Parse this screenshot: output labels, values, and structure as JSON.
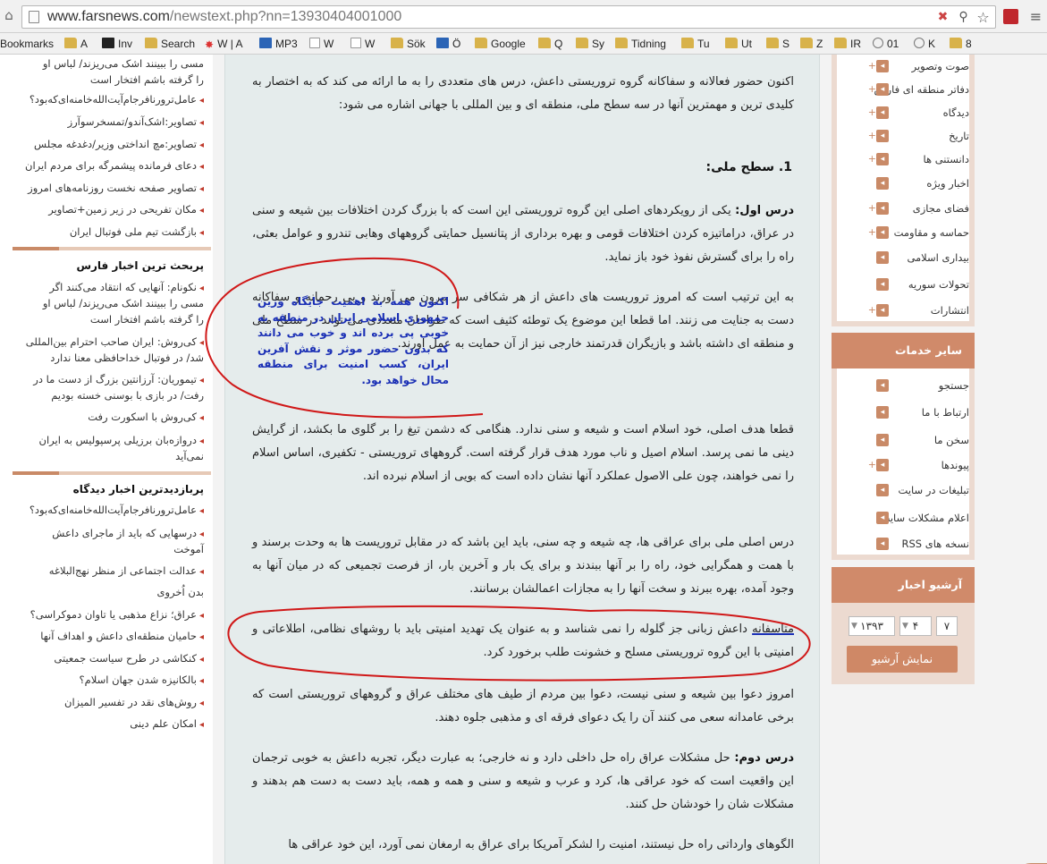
{
  "browser": {
    "url_host": "www.farsnews.com",
    "url_path": "/newstext.php?nn=13930404001000",
    "bookmarks_label": "Bookmarks",
    "bookmarks": [
      {
        "label": "A",
        "icon": "folder-icon"
      },
      {
        "label": "Inv",
        "icon": "page-icon"
      },
      {
        "label": "Search",
        "icon": "folder-icon"
      },
      {
        "label": "W | A",
        "icon": "sun-icon"
      },
      {
        "label": "MP3",
        "icon": "mp3-icon"
      },
      {
        "label": "W",
        "icon": "wiki-icon"
      },
      {
        "label": "W",
        "icon": "wiki-icon"
      },
      {
        "label": "Sök",
        "icon": "folder-icon"
      },
      {
        "label": "Ö",
        "icon": "app-icon"
      },
      {
        "label": "Google",
        "icon": "folder-icon"
      },
      {
        "label": "Q",
        "icon": "folder-icon"
      },
      {
        "label": "Sy",
        "icon": "folder-icon"
      },
      {
        "label": "Tidning",
        "icon": "folder-icon"
      },
      {
        "label": "Tu",
        "icon": "folder-icon"
      },
      {
        "label": "Ut",
        "icon": "folder-icon"
      },
      {
        "label": "S",
        "icon": "folder-icon"
      },
      {
        "label": "Z",
        "icon": "folder-icon"
      },
      {
        "label": "IR",
        "icon": "folder-icon"
      },
      {
        "label": "01",
        "icon": "clock-icon"
      },
      {
        "label": "K",
        "icon": "clock-icon"
      },
      {
        "label": "8",
        "icon": "folder-icon"
      }
    ]
  },
  "left": {
    "top_links": [
      "مسی را ببینند اشک می‌ریزند/ لباس او",
      "را گرفته باشم افتخار است",
      "عامل‌ترورنافرجام‌آیت‌الله‌خامنه‌ای‌که‌بود؟",
      "تصاویر:اشک‌آندو/تمسخرسوآرز",
      "تصاویر:مچ انداختی وزیر/دغدغه مجلس",
      "دعای فرمانده پیشمرگه برای مردم ایران",
      "تصاویر صفحه نخست روزنامه‌های امروز",
      "مکان تفریحی در زیر زمین+تصاویر",
      "بازگشت تیم ملی فوتبال ایران"
    ],
    "section1_title": "پربحث ترین اخبار فارس",
    "section1_links": [
      "نکونام: آنهایی که انتقاد می‌کنند اگر",
      "مسی را ببینند اشک می‌ریزند/ لباس او",
      "را گرفته باشم افتخار است",
      "کی‌روش: ایران صاحب احترام بین‌المللی",
      "شد/ در فوتبال خداحافظی معنا ندارد",
      "تیموریان: آرزانتین بزرگ از دست ما در",
      "رفت/ در بازی با بوسنی خسته بودیم",
      "کی‌روش با اسکورت رفت",
      "دروازه‌بان برزیلی پرسپولیس به ایران",
      "نمی‌آید"
    ],
    "section2_title": "پربازدیدترین اخبار دیدگاه",
    "section2_links": [
      "عامل‌ترورنافرجام‌آیت‌الله‌خامنه‌ای‌که‌بود؟",
      "درسهایی که باید از ماجرای داعش",
      "آموخت",
      "عدالت اجتماعی از منظر نهج‌البلاغه",
      "بدن اُخروی",
      "عراق؛ نزاع مذهبی یا تاوان دموکراسی؟",
      "حامیان منطقه‌ای داعش و اهداف آنها",
      "کنکاشی در طرح سیاست جمعیتی",
      "بالکانیزه شدن جهان اسلام؟",
      "روش‌های نقد در تفسیر المیزان",
      "امکان علم دینی"
    ]
  },
  "article": {
    "intro": "اکنون حضور فعالانه و سفاکانه گروه تروریستی داعش، درس های متعددی را به ما ارائه می کند که به اختصار به کلیدی ترین و مهمترین آنها در سه سطح ملی، منطقه ای و بین المللی با جهانی اشاره می شود:",
    "heading1": "1. سطح ملی:",
    "lesson1_label": "درس اول:",
    "lesson1_text": " یکی از رویکردهای اصلی این گروه تروریستی این است که با بزرگ کردن اختلافات بین شیعه و سنی در عراق، دراماتیزه کردن اختلافات قومی و بهره برداری از پتانسیل حمایتی گروههای وهابی تندرو و عوامل بعثی، راه را برای گسترش نفوذ خود باز نماید.",
    "p3": "به این ترتیب است که امروز تروریست های داعش از هر شکافی سر بیرون می آورند و بی رحمانه و سفاکانه دست به جنایت می زنند. اما قطعا این موضوع یک توطئه کثیف است که طراحان متعددی می تواند در سطح ملی و منطقه ای داشته باشد و بازیگران قدرتمند خارجی نیز از آن حمایت به عمل آورند.",
    "p4": "قطعا هدف اصلی، خود اسلام است و شیعه و سنی ندارد. هنگامی که دشمن تیغ را بر گلوی ما بکشد، از گرایش دینی ما نمی پرسد. اسلام اصیل و ناب مورد هدف قرار گرفته است. گروههای تروریستی - تکفیری، اساس اسلام را نمی خواهند، چون علی الاصول عملکرد آنها نشان داده است که بویی از اسلام نبرده اند.",
    "p5": "درس اصلی ملی برای عراقی ها، چه شیعه و چه سنی، باید این باشد که در مقابل تروریست ها به وحدت برسند و با همت و همگرایی خود، راه را بر آنها ببندند و برای یک بار و آخرین بار، از فرصت تجمیعی که در میان آنها به وجود آمده، بهره ببرند و سخت آنها را به مجازات اعمالشان برسانند.",
    "p6_first_word": "متاسفانه",
    "p6_rest": " داعش زبانی جز گلوله را نمی شناسد و به عنوان یک تهدید امنیتی باید با روشهای نظامی، اطلاعاتی و امنیتی با این گروه تروریستی مسلح و خشونت طلب برخورد کرد.",
    "p7": "امروز دعوا بین شیعه و سنی نیست، دعوا بین مردم از طیف های مختلف عراق و گروههای تروریستی است که برخی عامدانه سعی می کنند آن را یک دعوای فرقه ای و مذهبی جلوه دهند.",
    "lesson2_label": "درس دوم:",
    "lesson2_text": " حل مشکلات عراق راه حل داخلی دارد و نه خارجی؛ به عبارت دیگر، تجربه داعش به خوبی ترجمان این واقعیت است که خود عراقی ها، کرد و عرب و شیعه و سنی و همه و همه، باید دست به دست هم بدهند و مشکلات شان را خودشان حل کنند.",
    "p9": "الگوهای وارداتی راه حل نیستند، امنیت را لشکر آمریکا برای عراق به ارمغان نمی آورد، این خود عراقی ها",
    "callout": "اکنون همه به اهمیت جایگاه وزین جمهوری اسلامی ایران در منطقه به خوبی پی برده اند و خوب می دانند که بدون حضور موثر و نقش آفرین ایران، کسب امنیت برای منطقه محال خواهد بود."
  },
  "right": {
    "menu_items": [
      {
        "label": "صوت وتصویر",
        "plus": true
      },
      {
        "label": "دفاتر منطقه ای فارس",
        "plus": true
      },
      {
        "label": "دیدگاه",
        "plus": true
      },
      {
        "label": "تاریخ",
        "plus": true
      },
      {
        "label": "دانستنی ها",
        "plus": true
      },
      {
        "label": "اخبار ویژه",
        "plus": false
      },
      {
        "label": "فضای مجازی",
        "plus": true
      },
      {
        "label": "حماسه و مقاومت",
        "plus": true
      },
      {
        "label": "بیداری اسلامی",
        "plus": false
      },
      {
        "label": "تحولات سوریه",
        "plus": false
      },
      {
        "label": "انتشارات",
        "plus": true
      }
    ],
    "services_title": "سایر خدمات",
    "services": [
      {
        "label": "جستجو",
        "plus": false
      },
      {
        "label": "ارتباط با ما",
        "plus": false
      },
      {
        "label": "سخن ما",
        "plus": false
      },
      {
        "label": "پیوندها",
        "plus": true
      },
      {
        "label": "تبلیغات در سایت",
        "plus": false
      },
      {
        "label": "اعلام مشکلات سایت",
        "plus": false
      },
      {
        "label": "نسخه های RSS",
        "plus": false
      }
    ],
    "archive_title": "آرشیو اخبار",
    "archive_day": "۷",
    "archive_month": "۴",
    "archive_year": "۱۳۹۳",
    "archive_button": "نمایش آرشیو"
  },
  "colors": {
    "accent": "#c98a67",
    "annotation_red": "#d01818",
    "annotation_blue": "#1a2fb5"
  }
}
